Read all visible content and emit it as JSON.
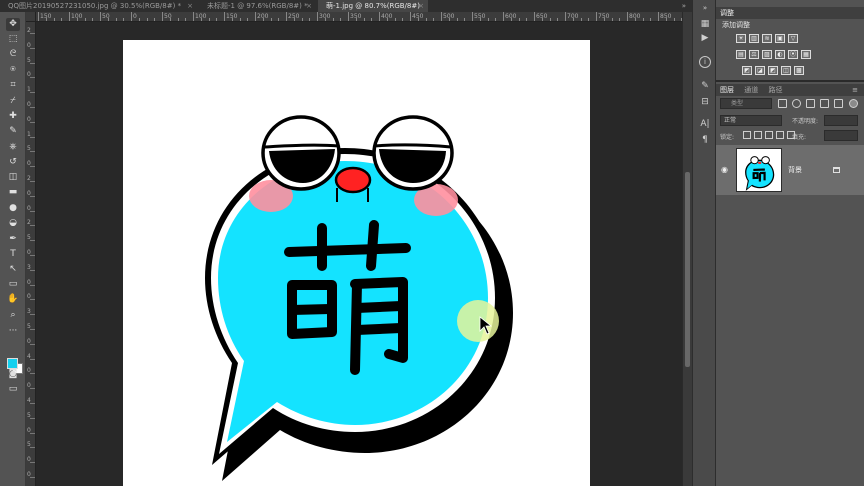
{
  "tabs": [
    {
      "label": "QQ图片20190527231050.jpg @ 30.5%(RGB/8#) *",
      "close": "×",
      "active": false
    },
    {
      "label": "未标题-1 @ 97.6%(RGB/8#) *",
      "close": "×",
      "active": false
    },
    {
      "label": "萌-1.jpg @ 80.7%(RGB/8#)",
      "close": "×",
      "active": true
    }
  ],
  "tab_menu": "»",
  "ruler_h_labels": [
    "150",
    "100",
    "50",
    "0",
    "50",
    "100",
    "150",
    "200",
    "250",
    "300",
    "350",
    "400",
    "450",
    "500",
    "550",
    "600",
    "650",
    "700",
    "750",
    "800",
    "850",
    "900"
  ],
  "ruler_v_labels": [
    "2",
    "0",
    "5",
    "0",
    "1",
    "0",
    "0",
    "1",
    "5",
    "0",
    "2",
    "0",
    "0",
    "2",
    "5",
    "0",
    "3",
    "0",
    "0",
    "3",
    "5",
    "0",
    "4",
    "0",
    "0",
    "4",
    "5",
    "0",
    "5",
    "0",
    "0"
  ],
  "canvas": {
    "character": "萌",
    "colors": {
      "bubble": "#14e3ff",
      "outline": "#000000",
      "shadow": "#000000",
      "cheek": "#ff8f9e",
      "nose": "#ff2222",
      "highlight": "#e6f59a"
    }
  },
  "toolbar": {
    "icons": [
      "move-icon",
      "marquee-icon",
      "lasso-icon",
      "quick-select-icon",
      "crop-icon",
      "eyedropper-icon",
      "spot-heal-icon",
      "brush-icon",
      "clone-stamp-icon",
      "history-brush-icon",
      "eraser-icon",
      "gradient-icon",
      "blur-icon",
      "dodge-icon",
      "pen-icon",
      "type-icon",
      "path-select-icon",
      "rectangle-icon",
      "hand-icon",
      "zoom-icon",
      "more-icon"
    ],
    "glyphs": [
      "✥",
      "⬚",
      "ᘓ",
      "⍟",
      "⌗",
      "⌿",
      "✚",
      "✎",
      "⎈",
      "↺",
      "◫",
      "▬",
      "●",
      "◒",
      "✒",
      "T",
      "↖",
      "▭",
      "✋",
      "⌕",
      "···"
    ],
    "fg_color": "#14d0ee",
    "bg_color": "#ffffff"
  },
  "iconstrip": {
    "top_menu": "»",
    "icons": [
      "color-icon",
      "play-icon",
      "info-icon",
      "brush-settings-icon",
      "adjust-icon",
      "character-icon",
      "paragraph-icon"
    ],
    "glyphs": [
      "▦",
      "▶",
      "i",
      "✎",
      "⊟",
      "A|",
      "¶"
    ]
  },
  "adjustments": {
    "header": "调整",
    "title": "添加调整",
    "row1": [
      "☀",
      "▥",
      "≋",
      "▣",
      "▽"
    ],
    "row2": [
      "▤",
      "⚖",
      "▨",
      "◐",
      "⦿",
      "▦"
    ],
    "row3": [
      "◩",
      "◪",
      "◩",
      "◫",
      "▩"
    ]
  },
  "layers_panel": {
    "tabs": [
      "图层",
      "通道",
      "路径"
    ],
    "menu": "≡",
    "filter_placeholder": "类型",
    "blend_mode": "正常",
    "opacity_label": "不透明度:",
    "lock_label": "锁定:",
    "fill_label": "填充:",
    "layer_name": "背景",
    "eye": "◉"
  }
}
